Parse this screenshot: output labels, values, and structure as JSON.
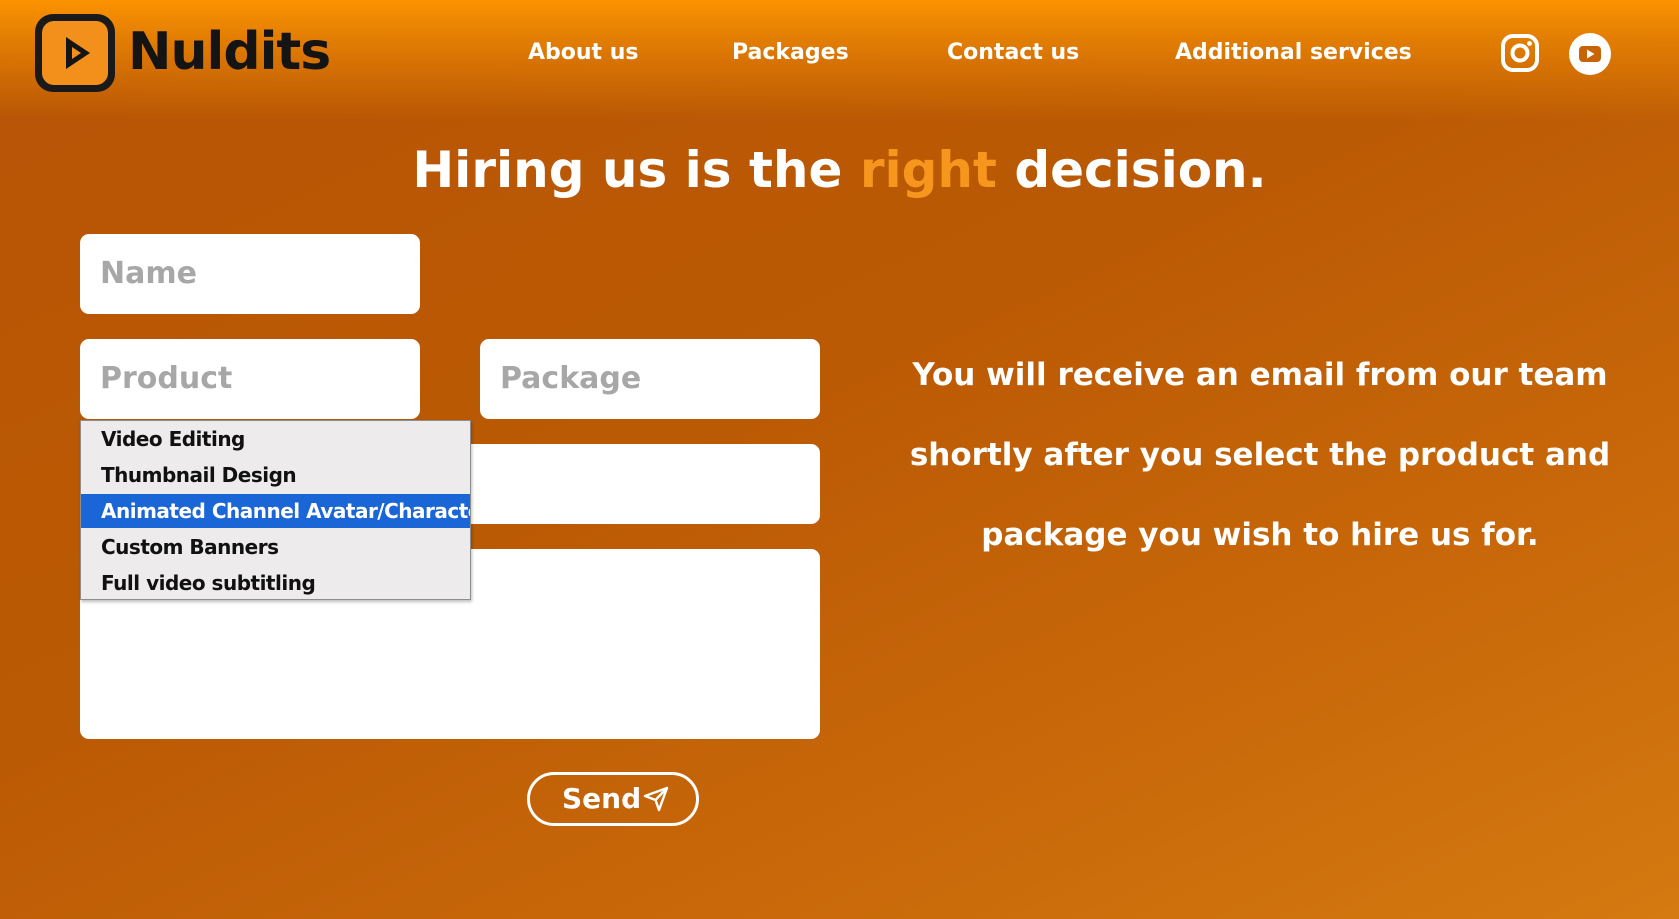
{
  "brand": {
    "name": "Nuldits",
    "logo_icon": "play-icon"
  },
  "nav": {
    "items": [
      {
        "label": "About us"
      },
      {
        "label": "Packages"
      },
      {
        "label": "Contact us"
      },
      {
        "label": "Additional services"
      }
    ],
    "social": [
      {
        "icon": "instagram-icon"
      },
      {
        "icon": "youtube-icon"
      }
    ]
  },
  "heading": {
    "before": "Hiring us is the",
    "accent": "right",
    "after": "decision.",
    "accent_color": "#f7961c"
  },
  "form": {
    "name_placeholder": "Name",
    "product_placeholder": "Product",
    "package_placeholder": "Package",
    "email_value": "",
    "message_value": "",
    "send_label": "Send",
    "send_icon": "paper-plane-icon"
  },
  "dropdown": {
    "options": [
      "Video Editing",
      "Thumbnail Design",
      "Animated Channel Avatar/Character",
      "Custom Banners",
      "Full video subtitling"
    ],
    "highlighted": "Animated Channel Avatar/Character",
    "highlight_color": "#1b66d6"
  },
  "info": {
    "line1": "You will receive an email from our team",
    "line2": "shortly after you select the product and",
    "line3": "package you wish to hire us for."
  },
  "colors": {
    "background": "#bb5a04",
    "header_glow": "#fb9302",
    "text": "#ffffff"
  }
}
